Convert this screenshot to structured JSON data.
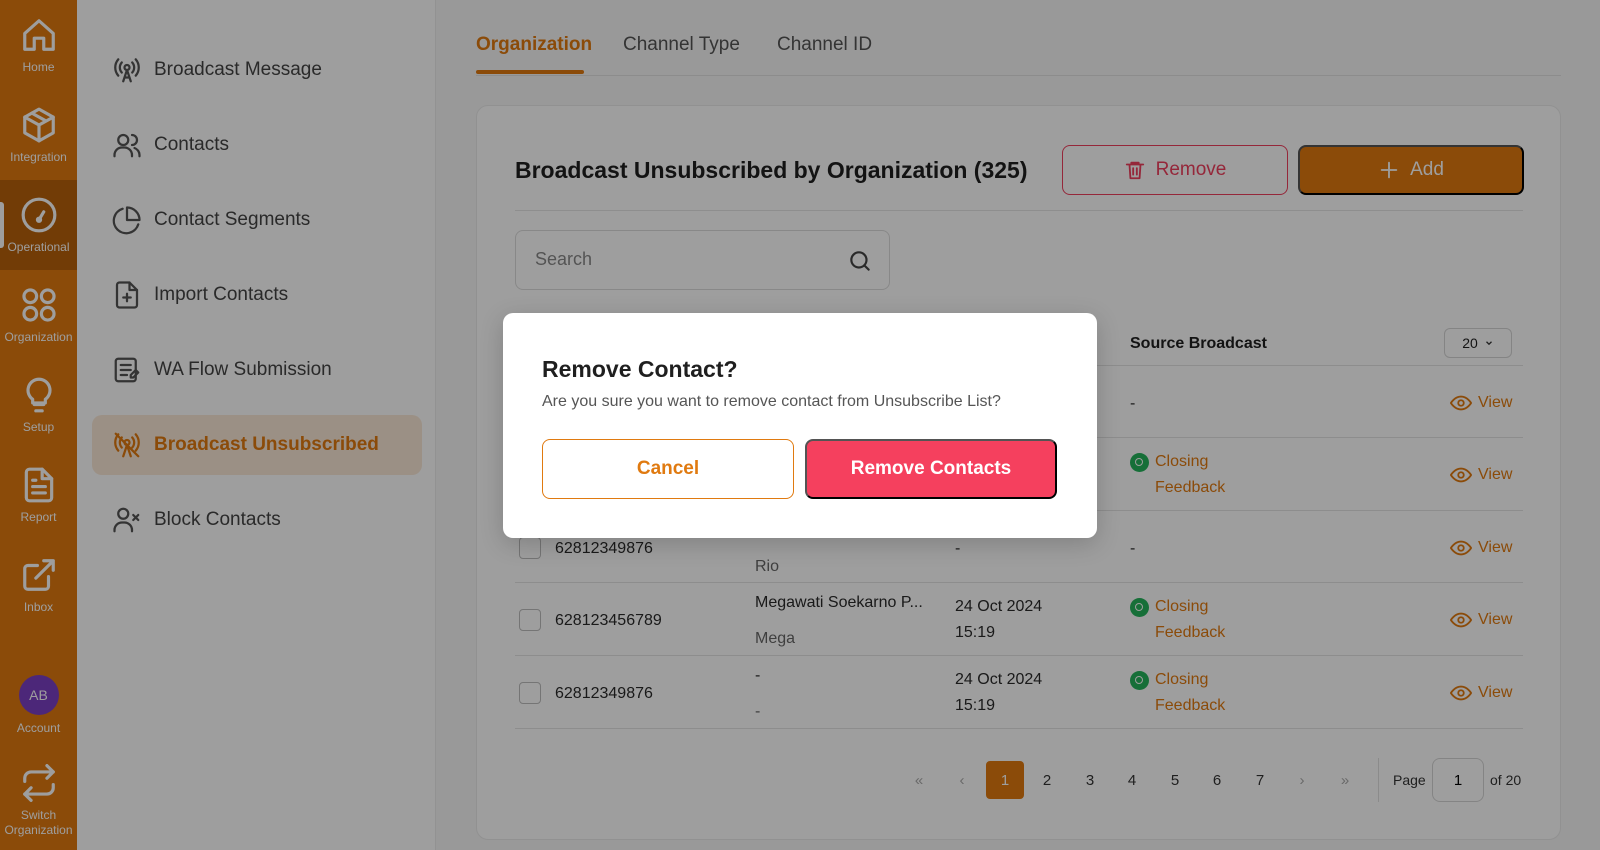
{
  "rail": {
    "items": [
      {
        "label": "Home",
        "icon": "home-icon"
      },
      {
        "label": "Integration",
        "icon": "cube-icon"
      },
      {
        "label": "Operational",
        "icon": "gauge-icon"
      },
      {
        "label": "Organization",
        "icon": "grid-circles-icon"
      },
      {
        "label": "Setup",
        "icon": "lightbulb-icon"
      },
      {
        "label": "Report",
        "icon": "document-icon"
      },
      {
        "label": "Inbox",
        "icon": "external-link-icon"
      }
    ],
    "account": {
      "initials": "AB",
      "label": "Account"
    },
    "switch": {
      "label": "Switch Organization"
    }
  },
  "submenu": {
    "items": [
      {
        "label": "Broadcast Message"
      },
      {
        "label": "Contacts"
      },
      {
        "label": "Contact Segments"
      },
      {
        "label": "Import Contacts"
      },
      {
        "label": "WA Flow Submission"
      },
      {
        "label": "Broadcast Unsubscribed"
      },
      {
        "label": "Block Contacts"
      }
    ]
  },
  "tabs": [
    {
      "label": "Organization"
    },
    {
      "label": "Channel Type"
    },
    {
      "label": "Channel ID"
    }
  ],
  "card": {
    "title": "Broadcast Unsubscribed by Organization (325)",
    "remove_label": "Remove",
    "add_label": "Add",
    "search_placeholder": "Search"
  },
  "table": {
    "source_header": "Source Broadcast",
    "per_page": "20",
    "view_label": "View",
    "rows": [
      {
        "phone": "",
        "name": "",
        "alias": "",
        "date": "",
        "time": "",
        "source": "-",
        "source2": ""
      },
      {
        "phone": "",
        "name": "",
        "alias": "",
        "date": "",
        "time": "",
        "source": "Closing",
        "source2": "Feedback"
      },
      {
        "phone": "62812349876",
        "name": "",
        "alias": "Rio",
        "date": "-",
        "time": "",
        "source": "-",
        "source2": ""
      },
      {
        "phone": "628123456789",
        "name": "Megawati Soekarno P...",
        "alias": "Mega",
        "date": "24 Oct 2024",
        "time": "15:19",
        "source": "Closing",
        "source2": "Feedback"
      },
      {
        "phone": "62812349876",
        "name": "-",
        "alias": "-",
        "date": "24 Oct 2024",
        "time": "15:19",
        "source": "Closing",
        "source2": "Feedback"
      }
    ]
  },
  "pagination": {
    "pages": [
      "1",
      "2",
      "3",
      "4",
      "5",
      "6",
      "7"
    ],
    "current": "1",
    "page_label": "Page",
    "of_label": "of 20"
  },
  "modal": {
    "title": "Remove Contact?",
    "message": "Are you sure you want to remove contact from Unsubscribe List?",
    "cancel_label": "Cancel",
    "confirm_label": "Remove Contacts"
  },
  "colors": {
    "accent": "#e07a10",
    "danger": "#f5405e",
    "whatsapp": "#25b35b"
  }
}
